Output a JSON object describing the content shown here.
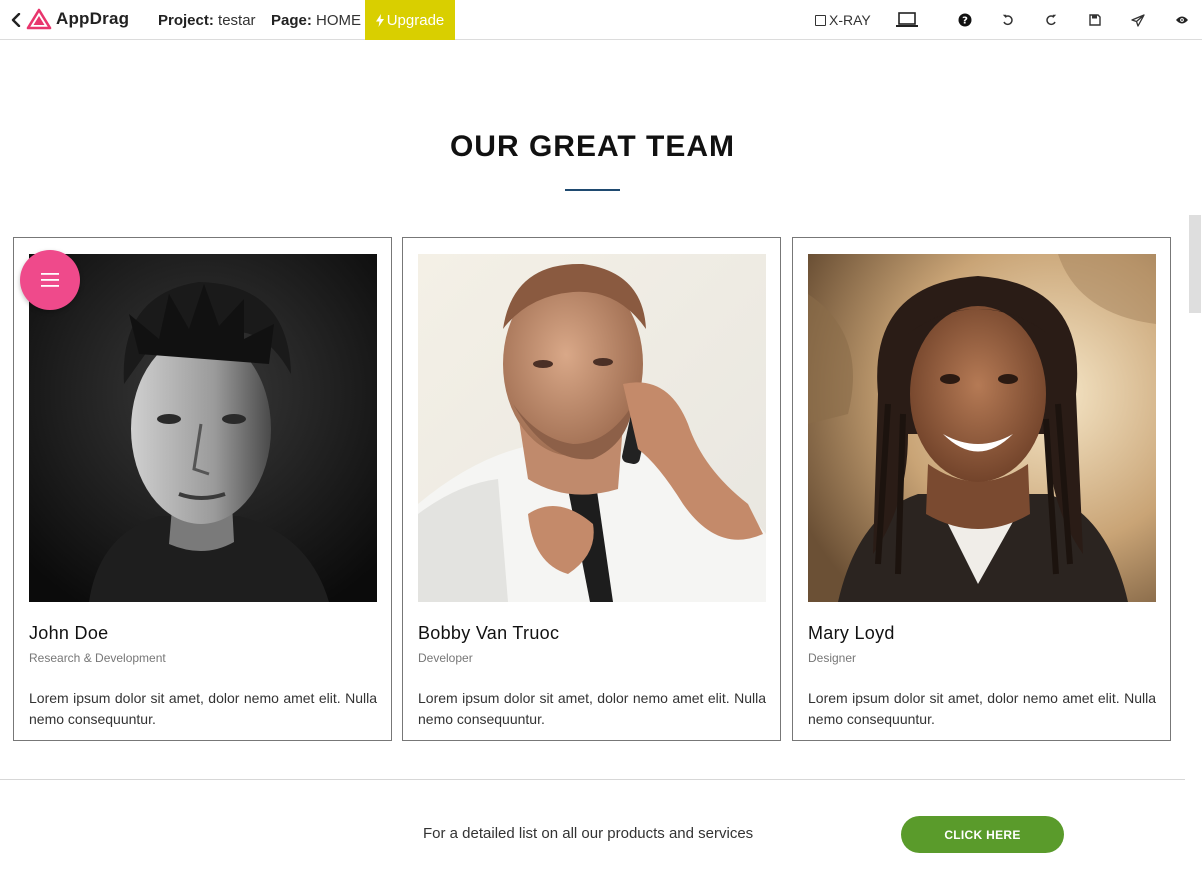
{
  "toolbar": {
    "logo_text": "AppDrag",
    "project_label": "Project:",
    "project_name": "testar",
    "page_label": "Page:",
    "page_name": "HOME",
    "upgrade_label": "Upgrade",
    "xray_label": "X-RAY",
    "upgrade_color": "#d9cf00",
    "brand_color": "#e8356d"
  },
  "team": {
    "title": "OUR GREAT TEAM",
    "members": [
      {
        "name": "John Doe",
        "role": "Research & Development",
        "description": "Lorem ipsum dolor sit amet, dolor nemo amet elit. Nulla nemo consequuntur.",
        "photo": "portrait-man-black-and-white"
      },
      {
        "name": "Bobby Van Truoc",
        "role": "Developer",
        "description": "Lorem ipsum dolor sit amet, dolor nemo amet elit. Nulla nemo consequuntur.",
        "photo": "portrait-man-on-phone"
      },
      {
        "name": "Mary Loyd",
        "role": "Designer",
        "description": "Lorem ipsum dolor sit amet, dolor nemo amet elit. Nulla nemo consequuntur.",
        "photo": "portrait-woman-smiling"
      }
    ]
  },
  "cta": {
    "text": "For a detailed list on all our products and services",
    "button_label": "CLICK HERE",
    "button_color": "#5a9b2b"
  },
  "fab": {
    "icon": "hamburger-menu-icon",
    "color": "#ef4a8b"
  }
}
